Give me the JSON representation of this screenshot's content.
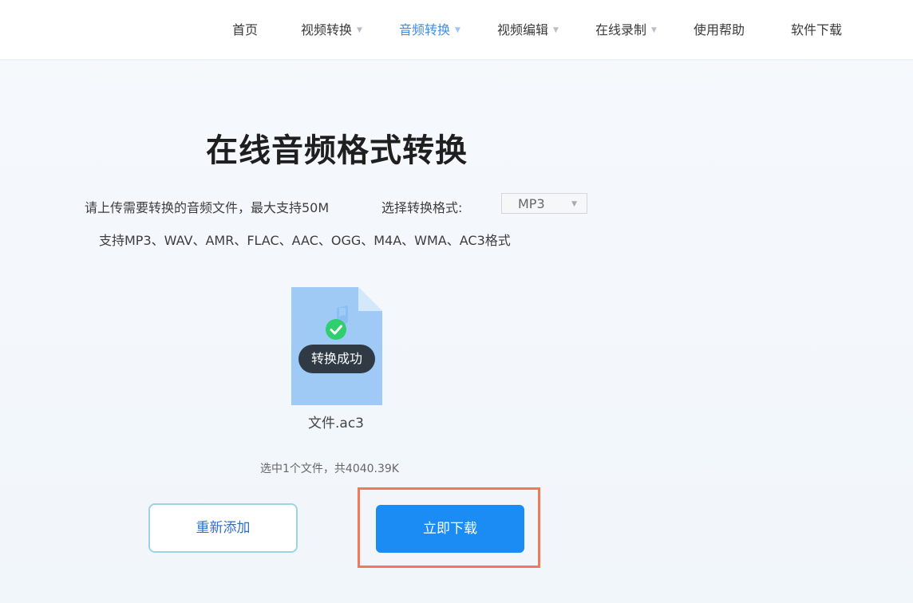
{
  "nav": {
    "items": [
      {
        "label": "首页",
        "has_dropdown": false,
        "active": false
      },
      {
        "label": "视频转换",
        "has_dropdown": true,
        "active": false
      },
      {
        "label": "音频转换",
        "has_dropdown": true,
        "active": true
      },
      {
        "label": "视频编辑",
        "has_dropdown": true,
        "active": false
      },
      {
        "label": "在线录制",
        "has_dropdown": true,
        "active": false
      },
      {
        "label": "使用帮助",
        "has_dropdown": false,
        "active": false
      },
      {
        "label": "软件下载",
        "has_dropdown": false,
        "active": false
      }
    ],
    "caret_glyph": "▼"
  },
  "main": {
    "title": "在线音频格式转换",
    "upload_hint": "请上传需要转换的音频文件，最大支持50M",
    "format_label": "选择转换格式:",
    "format_select": {
      "value": "MP3",
      "caret": "▼"
    },
    "supported_formats": "支持MP3、WAV、AMR、FLAC、AAC、OGG、M4A、WMA、AC3格式"
  },
  "file": {
    "icon": "audio-file-icon",
    "status_icon": "check-circle-icon",
    "status_text": "转换成功",
    "name": "文件.ac3"
  },
  "selection_info": "选中1个文件，共4040.39K",
  "buttons": {
    "readd": "重新添加",
    "download": "立即下载"
  },
  "colors": {
    "accent": "#1a8cf3",
    "active_nav": "#3b8ef0",
    "success": "#2ecf6c",
    "highlight": "#f07a57",
    "file_icon": "#9fcaf5"
  }
}
